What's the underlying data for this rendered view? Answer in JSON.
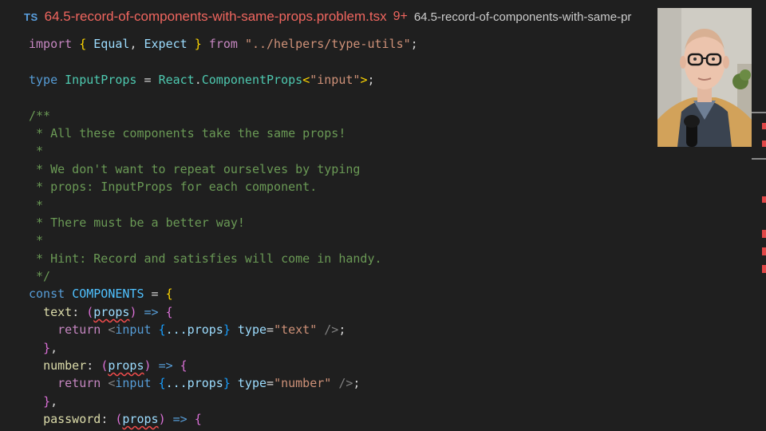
{
  "tab": {
    "lang_badge": "TS",
    "filename": "64.5-record-of-components-with-same-props.problem.tsx",
    "problem_count": "9+",
    "breadcrumb": "64.5-record-of-components-with-same-pr"
  },
  "code": {
    "l1": {
      "a": "import",
      "b": "{",
      "c": "Equal",
      "d": ",",
      "e": "Expect",
      "f": "}",
      "g": "from",
      "h": "\"../helpers/type-utils\"",
      "i": ";"
    },
    "l3": {
      "a": "type",
      "b": "InputProps",
      "c": "=",
      "d": "React",
      "e": ".",
      "f": "ComponentProps",
      "g": "<",
      "h": "\"input\"",
      "i": ">",
      "j": ";"
    },
    "l5": "/**",
    "l6": " * All these components take the same props!",
    "l7": " *",
    "l8": " * We don't want to repeat ourselves by typing",
    "l9": " * props: InputProps for each component.",
    "l10": " *",
    "l11": " * There must be a better way!",
    "l12": " *",
    "l13": " * Hint: Record and satisfies will come in handy.",
    "l14": " */",
    "l15": {
      "a": "const",
      "b": "COMPONENTS",
      "c": "=",
      "d": "{"
    },
    "l16": {
      "a": "text",
      "b": ":",
      "c": "(",
      "d": "props",
      "e": ")",
      "f": "=>",
      "g": "{"
    },
    "l17": {
      "a": "return",
      "b": "<",
      "c": "input",
      "d": "{",
      "e": "...props",
      "f": "}",
      "g": "type",
      "h": "=",
      "i": "\"text\"",
      "j": "/>",
      "k": ";"
    },
    "l18": {
      "a": "}",
      "b": ","
    },
    "l19": {
      "a": "number",
      "b": ":",
      "c": "(",
      "d": "props",
      "e": ")",
      "f": "=>",
      "g": "{"
    },
    "l20": {
      "a": "return",
      "b": "<",
      "c": "input",
      "d": "{",
      "e": "...props",
      "f": "}",
      "g": "type",
      "h": "=",
      "i": "\"number\"",
      "j": "/>",
      "k": ";"
    },
    "l21": {
      "a": "}",
      "b": ","
    },
    "l22": {
      "a": "password",
      "b": ":",
      "c": "(",
      "d": "props",
      "e": ")",
      "f": "=>",
      "g": "{"
    }
  },
  "colors": {
    "background": "#1f1f1f",
    "tab_error": "#f0665f",
    "comment": "#6a9955",
    "keyword": "#569cd6",
    "string": "#ce9178",
    "error_marker": "#e04646"
  }
}
